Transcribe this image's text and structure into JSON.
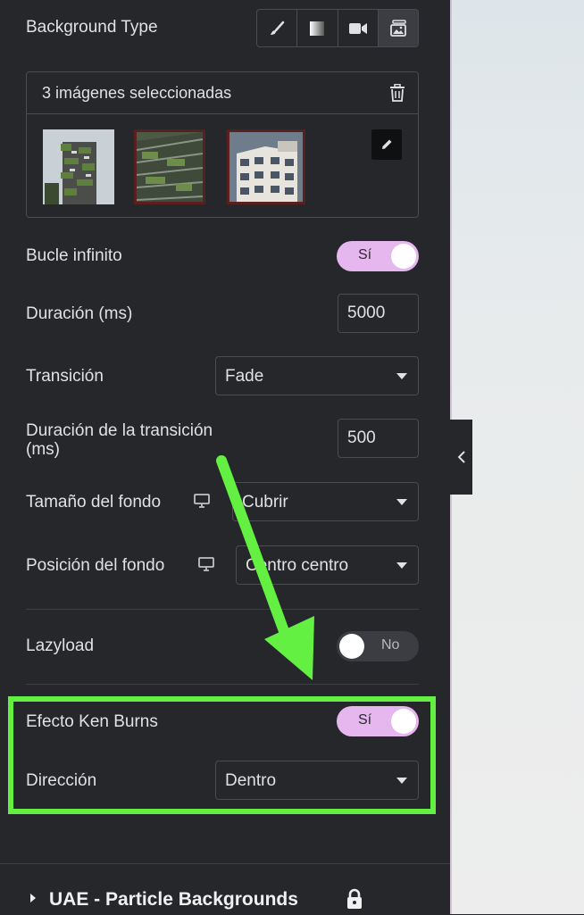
{
  "background_type": {
    "label": "Background Type",
    "options": [
      "brush-icon",
      "gradient-icon",
      "video-icon",
      "slideshow-icon"
    ],
    "active": "slideshow-icon"
  },
  "gallery": {
    "title": "3 imágenes seleccionadas",
    "images": [
      "vertical-forest-tower",
      "green-facade-building",
      "white-apartment-building"
    ]
  },
  "loop": {
    "label": "Bucle infinito",
    "value": "Sí",
    "on": true
  },
  "duration": {
    "label": "Duración (ms)",
    "value": "5000"
  },
  "transition": {
    "label": "Transición",
    "value": "Fade"
  },
  "transition_duration": {
    "label": "Duración de la transición (ms)",
    "value": "500"
  },
  "bg_size": {
    "label": "Tamaño del fondo",
    "value": "Cubrir"
  },
  "bg_position": {
    "label": "Posición del fondo",
    "value": "Centro centro"
  },
  "lazyload": {
    "label": "Lazyload",
    "value": "No",
    "on": false
  },
  "ken_burns": {
    "label": "Efecto Ken Burns",
    "value": "Sí",
    "on": true
  },
  "direction": {
    "label": "Dirección",
    "value": "Dentro"
  },
  "section": {
    "title": "UAE - Particle Backgrounds"
  },
  "colors": {
    "accent_toggle": "#e6b6ef",
    "annotation": "#64f042",
    "panel": "#26272b"
  }
}
